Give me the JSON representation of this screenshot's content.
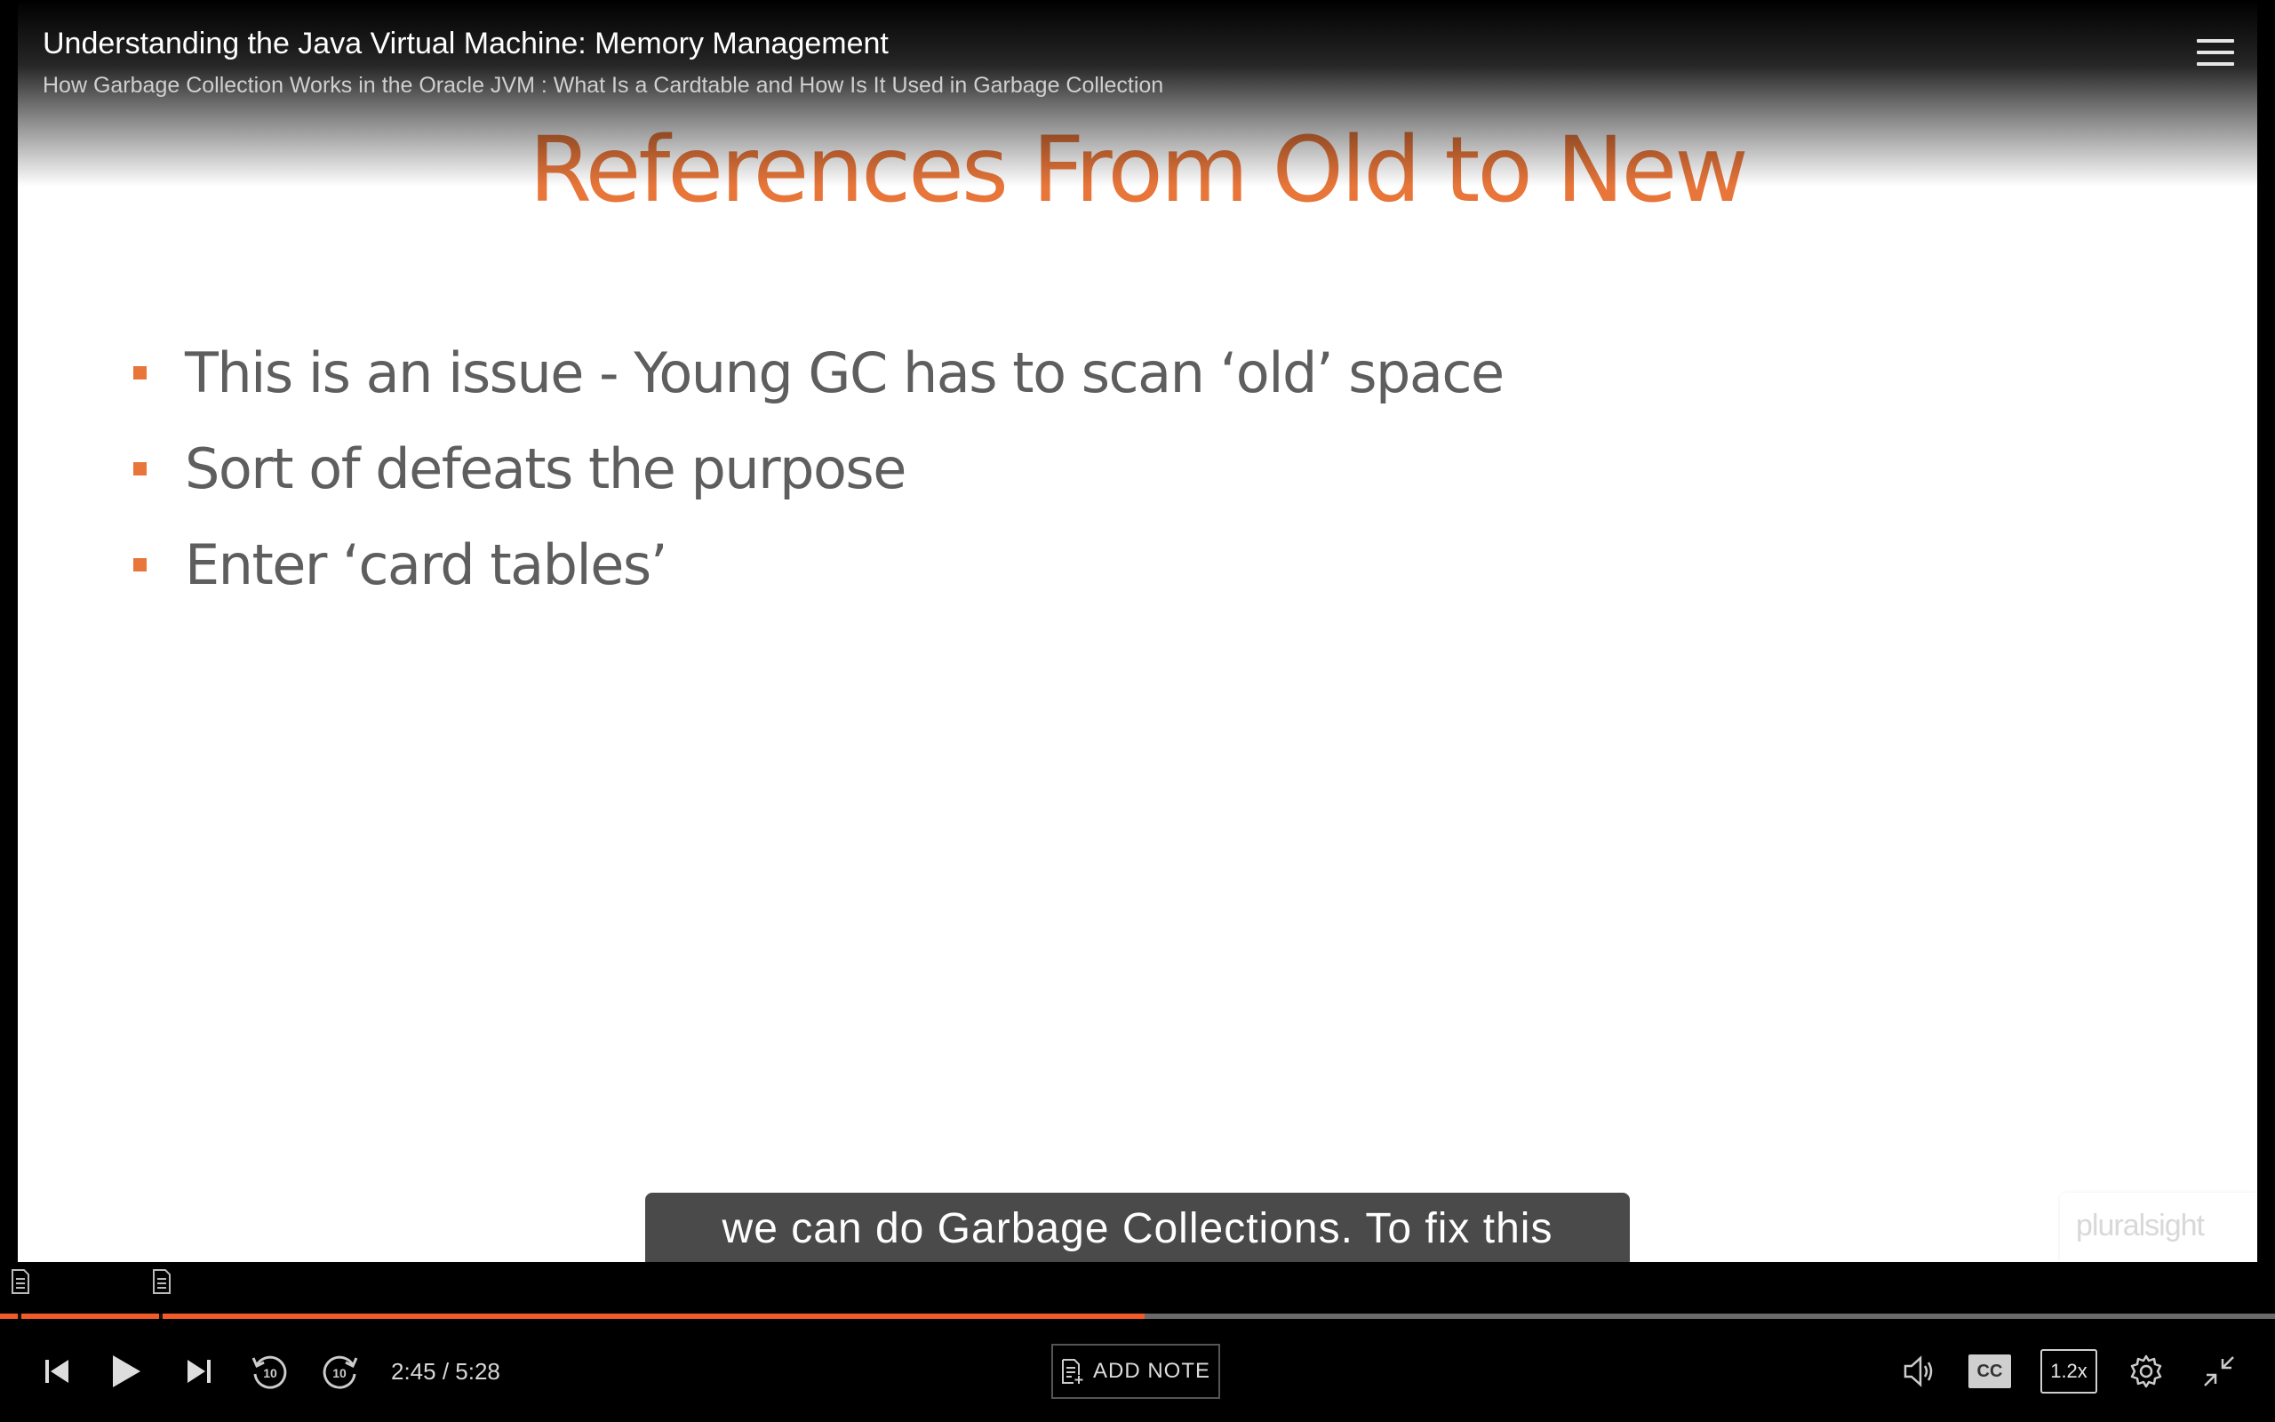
{
  "header": {
    "course_title": "Understanding the Java Virtual Machine: Memory Management",
    "module_title": "How Garbage Collection Works in the Oracle JVM : What Is a Cardtable and How Is It Used in Garbage Collection",
    "menu_icon": "hamburger-menu-icon"
  },
  "slide": {
    "title": "References From Old to New",
    "bullets": [
      "This is an issue - Young GC has to scan ‘old’ space",
      "Sort of defeats the purpose",
      "Enter ‘card tables’"
    ],
    "title_color": "#e8763a"
  },
  "caption": "we can do Garbage Collections. To fix this",
  "watermark": "pluralsight",
  "player": {
    "current_time": "2:45",
    "duration": "5:28",
    "time_display": "2:45 / 5:28",
    "progress_fraction": 0.503,
    "add_note_label": "ADD NOTE",
    "cc_label": "CC",
    "speed_label": "1.2x",
    "accent_color": "#f15b2a",
    "icons": [
      "previous-icon",
      "play-icon",
      "next-icon",
      "rewind-10-icon",
      "forward-10-icon",
      "volume-icon",
      "settings-icon",
      "exit-fullscreen-icon"
    ],
    "skip_seconds": "10"
  }
}
